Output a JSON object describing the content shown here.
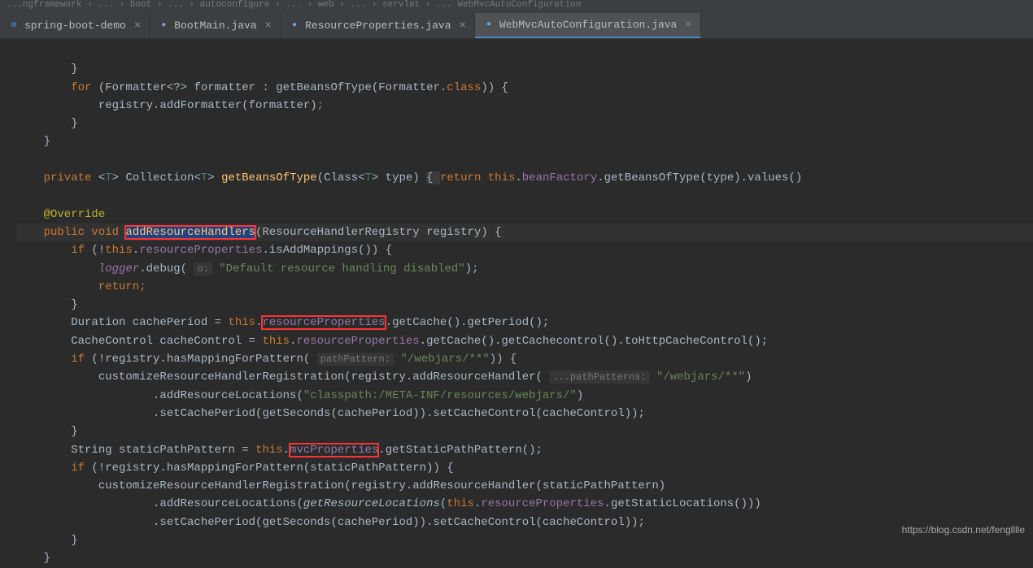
{
  "breadcrumb": "...ngframework › ... › boot › ... › autoconfigure › ... › web › ... › servlet › ... WebMvcAutoConfiguration",
  "tabs": [
    {
      "label": "spring-boot-demo",
      "icon": "m",
      "iconColor": "#4a88c7",
      "active": false
    },
    {
      "label": "BootMain.java",
      "icon": "●",
      "iconColor": "#6ba3d8",
      "active": false
    },
    {
      "label": "ResourceProperties.java",
      "icon": "●",
      "iconColor": "#6ba3d8",
      "active": false
    },
    {
      "label": "WebMvcAutoConfiguration.java",
      "icon": "●",
      "iconColor": "#6ba3d8",
      "active": true
    }
  ],
  "code": {
    "l1": "        }",
    "l2a": "        for",
    "l2b": " (Formatter<?> formatter : getBeansOfType(Formatter.",
    "l2c": "class",
    "l2d": ")) {",
    "l3a": "            registry.addFormatter(formatter)",
    "l3b": ";",
    "l4": "        }",
    "l5": "    }",
    "l6": "",
    "l7a": "    private",
    "l7b": " <",
    "l7c": "T",
    "l7d": "> Collection<",
    "l7e": "T",
    "l7f": "> ",
    "l7g": "getBeansOfType",
    "l7h": "(Class<",
    "l7i": "T",
    "l7j": "> type) ",
    "l7k": "{ ",
    "l7l": "return ",
    "l7m": "this",
    "l7n": ".",
    "l7o": "beanFactory",
    "l7p": ".getBeansOfType(type).values()",
    "l8": "",
    "l9a": "    @Override",
    "l10a": "    public void ",
    "l10b": "addResourceHandlers",
    "l10c": "(ResourceHandlerRegistry registry) {",
    "l11a": "        if",
    "l11b": " (!",
    "l11c": "this",
    "l11d": ".",
    "l11e": "resourceProperties",
    "l11f": ".isAddMappings()) {",
    "l12a": "            logger",
    "l12b": ".debug( ",
    "l12hint": "o:",
    "l12c": " \"Default resource handling disabled\"",
    "l12d": ");",
    "l13a": "            return;",
    "l14": "        }",
    "l15a": "        Duration cachePeriod = ",
    "l15b": "this",
    "l15c": ".",
    "l15d": "resourceProperties",
    "l15e": ".getCache().getPeriod();",
    "l16a": "        CacheControl cacheControl = ",
    "l16b": "this",
    "l16c": ".",
    "l16d": "resourceProperties",
    "l16e": ".getCache().getCachecontrol().toHttpCacheControl();",
    "l17a": "        if",
    "l17b": " (!registry.hasMappingForPattern( ",
    "l17hint": "pathPattern:",
    "l17c": " \"/webjars/**\"",
    "l17d": ")) {",
    "l18a": "            customizeResourceHandlerRegistration(registry.addResourceHandler( ",
    "l18hint": "...pathPatterns:",
    "l18b": " \"/webjars/**\"",
    "l18c": ")",
    "l19a": "                    .addResourceLocations(",
    "l19b": "\"classpath:/META-INF/resources/webjars/\"",
    "l19c": ")",
    "l20a": "                    .setCachePeriod(getSeconds(cachePeriod)).setCacheControl(cacheControl));",
    "l21": "        }",
    "l22a": "        String staticPathPattern = ",
    "l22b": "this",
    "l22c": ".",
    "l22d": "mvcProperties",
    "l22e": ".getStaticPathPattern();",
    "l23a": "        if",
    "l23b": " (!registry.hasMappingForPattern(staticPathPattern)) {",
    "l24a": "            customizeResourceHandlerRegistration(registry.addResourceHandler(staticPathPattern)",
    "l25a": "                    .addResourceLocations(",
    "l25b": "getResourceLocations",
    "l25c": "(",
    "l25d": "this",
    "l25e": ".",
    "l25f": "resourceProperties",
    "l25g": ".getStaticLocations()))",
    "l26a": "                    .setCachePeriod(getSeconds(cachePeriod)).setCacheControl(cacheControl));",
    "l27": "        }",
    "l28": "    }"
  },
  "watermark": "https://blog.csdn.net/fenglllle"
}
